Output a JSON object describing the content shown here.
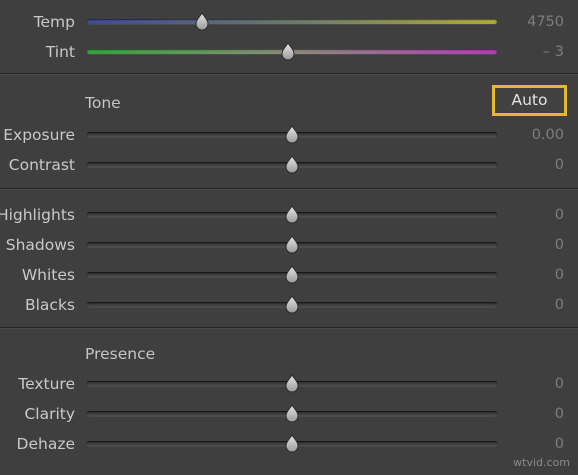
{
  "basic_panel": {
    "white_balance": {
      "temp": {
        "label": "Temp",
        "value": "4750",
        "position": 0.28
      },
      "tint": {
        "label": "Tint",
        "value": "– 3",
        "position": 0.49
      }
    },
    "tone": {
      "title": "Tone",
      "auto_label": "Auto",
      "sliders": [
        {
          "key": "exposure",
          "label": "Exposure",
          "value": "0.00",
          "position": 0.5
        },
        {
          "key": "contrast",
          "label": "Contrast",
          "value": "0",
          "position": 0.5
        },
        {
          "key": "highlights",
          "label": "Highlights",
          "value": "0",
          "position": 0.5
        },
        {
          "key": "shadows",
          "label": "Shadows",
          "value": "0",
          "position": 0.5
        },
        {
          "key": "whites",
          "label": "Whites",
          "value": "0",
          "position": 0.5
        },
        {
          "key": "blacks",
          "label": "Blacks",
          "value": "0",
          "position": 0.5
        }
      ]
    },
    "presence": {
      "title": "Presence",
      "sliders": [
        {
          "key": "texture",
          "label": "Texture",
          "value": "0",
          "position": 0.5
        },
        {
          "key": "clarity",
          "label": "Clarity",
          "value": "0",
          "position": 0.5
        },
        {
          "key": "dehaze",
          "label": "Dehaze",
          "value": "0",
          "position": 0.5
        }
      ]
    }
  },
  "colors": {
    "panel_bg": "#3f3f3f",
    "auto_highlight": "#e6b532",
    "temp_gradient": [
      "#3c4a9a",
      "#b0aa3c"
    ],
    "tint_gradient": [
      "#33a23a",
      "#b03cb5"
    ]
  },
  "watermark": "wtvid.com"
}
